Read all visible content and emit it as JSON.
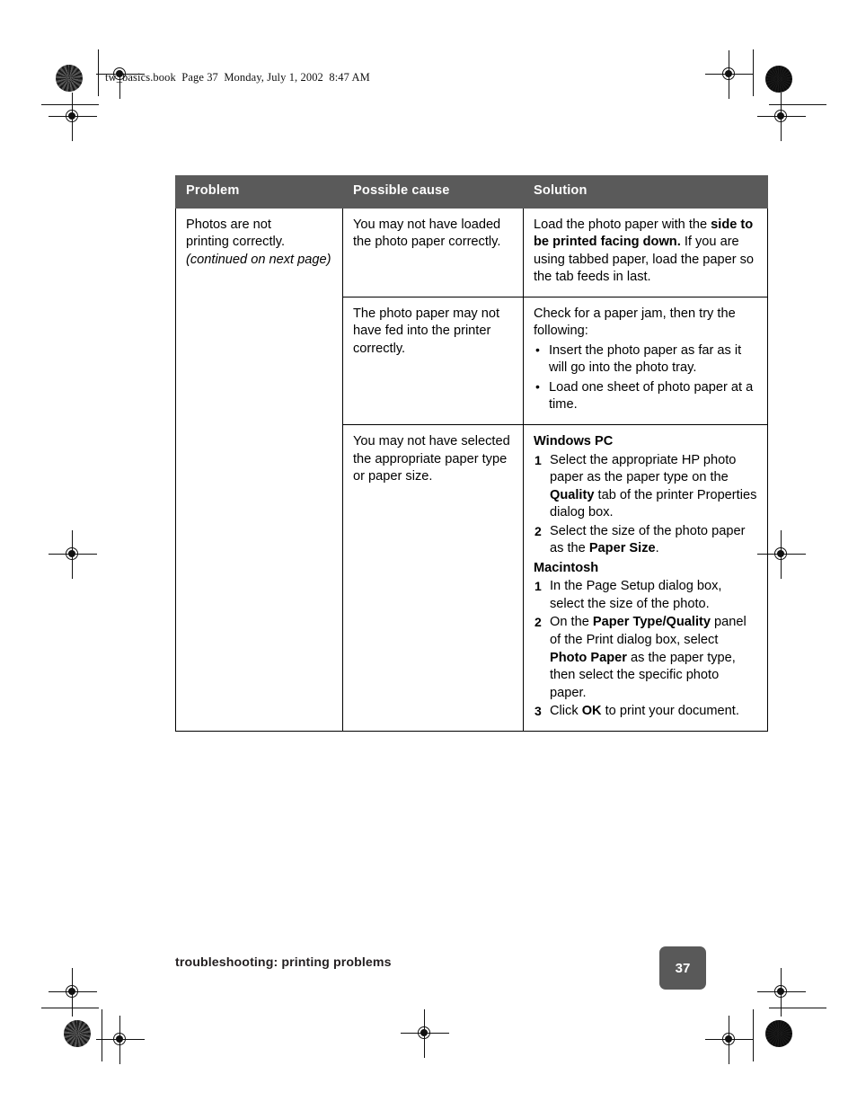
{
  "prepress": {
    "running_header": "tw_basics.book  Page 37  Monday, July 1, 2002  8:47 AM"
  },
  "table": {
    "headers": [
      "Problem",
      "Possible cause",
      "Solution"
    ],
    "header_bg": "#5a5a5a",
    "header_color": "#ffffff",
    "problem_cell": {
      "line1": "Photos are not",
      "line2": "printing correctly.",
      "continued": "(continued on next page)"
    },
    "rows": [
      {
        "cause": "You may not have loaded the photo paper correctly.",
        "solution_parts": [
          {
            "text": "Load the photo paper with the ",
            "bold": false
          },
          {
            "text": "side to be printed facing down.",
            "bold": true
          },
          {
            "text": " If you are using tabbed paper, load the paper so the tab feeds in last.",
            "bold": false
          }
        ]
      },
      {
        "cause": "The photo paper may not have fed into the printer correctly.",
        "solution_intro": "Check for a paper jam, then try the following:",
        "bullets": [
          "Insert the photo paper as far as it will go into the photo tray.",
          "Load one sheet of photo paper at a time."
        ]
      },
      {
        "cause": "You may not have selected the appropriate paper type or paper size.",
        "windows_heading": "Windows PC",
        "windows_steps": [
          [
            {
              "text": "Select the appropriate HP photo paper as the paper type on the ",
              "bold": false
            },
            {
              "text": "Quality",
              "bold": true
            },
            {
              "text": " tab of the printer Properties dialog box.",
              "bold": false
            }
          ],
          [
            {
              "text": "Select the size of the photo paper as the ",
              "bold": false
            },
            {
              "text": "Paper Size",
              "bold": true
            },
            {
              "text": ".",
              "bold": false
            }
          ]
        ],
        "mac_heading": "Macintosh",
        "mac_steps": [
          [
            {
              "text": "In the Page Setup dialog box, select the size of the photo.",
              "bold": false
            }
          ],
          [
            {
              "text": "On the ",
              "bold": false
            },
            {
              "text": "Paper Type/Quality",
              "bold": true
            },
            {
              "text": " panel of the Print dialog box, select ",
              "bold": false
            },
            {
              "text": "Photo Paper",
              "bold": true
            },
            {
              "text": " as the paper type, then select the specific photo paper.",
              "bold": false
            }
          ],
          [
            {
              "text": "Click ",
              "bold": false
            },
            {
              "text": "OK",
              "bold": true
            },
            {
              "text": " to print your document.",
              "bold": false
            }
          ]
        ]
      }
    ]
  },
  "footer": {
    "label": "troubleshooting: printing problems",
    "page_number": "37",
    "badge_color": "#595959"
  }
}
